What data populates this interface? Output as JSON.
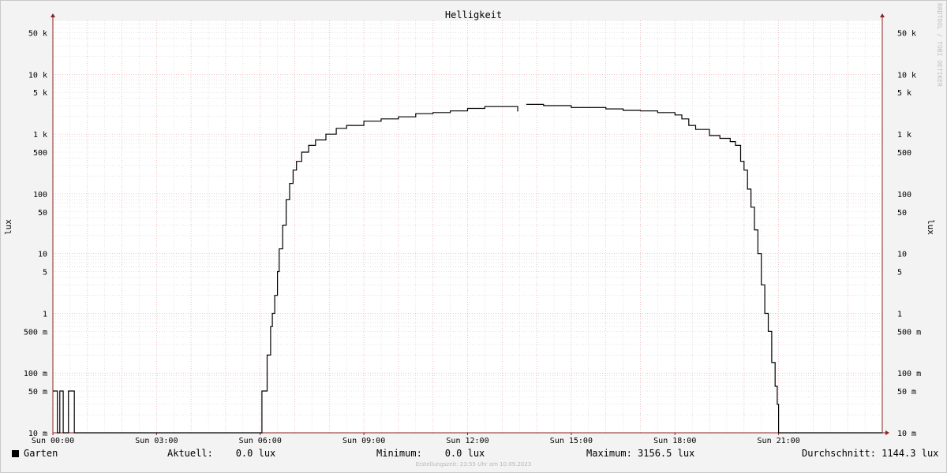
{
  "chart_data": {
    "type": "line",
    "title": "Helligkeit",
    "ylabel": "lux",
    "y_scale": "log",
    "ylim": [
      0.01,
      80000
    ],
    "xlim": [
      0,
      24
    ],
    "x_ticks": [
      {
        "hour": 0,
        "label": "Sun 00:00"
      },
      {
        "hour": 3,
        "label": "Sun 03:00"
      },
      {
        "hour": 6,
        "label": "Sun 06:00"
      },
      {
        "hour": 9,
        "label": "Sun 09:00"
      },
      {
        "hour": 12,
        "label": "Sun 12:00"
      },
      {
        "hour": 15,
        "label": "Sun 15:00"
      },
      {
        "hour": 18,
        "label": "Sun 18:00"
      },
      {
        "hour": 21,
        "label": "Sun 21:00"
      }
    ],
    "y_ticks": [
      {
        "value": 50000,
        "label": "50 k"
      },
      {
        "value": 10000,
        "label": "10 k"
      },
      {
        "value": 5000,
        "label": "5 k"
      },
      {
        "value": 1000,
        "label": "1 k"
      },
      {
        "value": 500,
        "label": "500"
      },
      {
        "value": 100,
        "label": "100"
      },
      {
        "value": 50,
        "label": "50"
      },
      {
        "value": 10,
        "label": "10"
      },
      {
        "value": 5,
        "label": "5"
      },
      {
        "value": 1,
        "label": "1"
      },
      {
        "value": 0.5,
        "label": "500 m"
      },
      {
        "value": 0.1,
        "label": "100 m"
      },
      {
        "value": 0.05,
        "label": "50 m"
      },
      {
        "value": 0.01,
        "label": "10 m"
      }
    ],
    "series": [
      {
        "name": "Garten",
        "color": "#000000",
        "points": [
          [
            0.0,
            0.05
          ],
          [
            0.13,
            0.05
          ],
          [
            0.13,
            0.0
          ],
          [
            0.2,
            0.0
          ],
          [
            0.2,
            0.05
          ],
          [
            0.3,
            0.05
          ],
          [
            0.3,
            0.0
          ],
          [
            0.45,
            0.0
          ],
          [
            0.45,
            0.05
          ],
          [
            0.62,
            0.05
          ],
          [
            0.62,
            0.0
          ],
          [
            6.0,
            0.0
          ],
          [
            6.05,
            0.05
          ],
          [
            6.15,
            0.05
          ],
          [
            6.2,
            0.2
          ],
          [
            6.3,
            0.6
          ],
          [
            6.35,
            1.0
          ],
          [
            6.42,
            2.0
          ],
          [
            6.5,
            5.0
          ],
          [
            6.55,
            12.0
          ],
          [
            6.65,
            30.0
          ],
          [
            6.75,
            80.0
          ],
          [
            6.85,
            150.0
          ],
          [
            6.95,
            250.0
          ],
          [
            7.05,
            350.0
          ],
          [
            7.2,
            500.0
          ],
          [
            7.4,
            650.0
          ],
          [
            7.6,
            800.0
          ],
          [
            7.9,
            1000.0
          ],
          [
            8.2,
            1250.0
          ],
          [
            8.5,
            1400.0
          ],
          [
            9.0,
            1650.0
          ],
          [
            9.5,
            1800.0
          ],
          [
            10.0,
            1950.0
          ],
          [
            10.5,
            2200.0
          ],
          [
            11.0,
            2300.0
          ],
          [
            11.5,
            2450.0
          ],
          [
            12.0,
            2700.0
          ],
          [
            12.5,
            2900.0
          ],
          [
            13.0,
            2900.0
          ],
          [
            13.4,
            2900.0
          ],
          [
            13.45,
            2400.0
          ],
          [
            13.5,
            null
          ],
          [
            13.7,
            3156.5
          ],
          [
            14.2,
            3000.0
          ],
          [
            15.0,
            2800.0
          ],
          [
            16.0,
            2650.0
          ],
          [
            16.5,
            2500.0
          ],
          [
            17.0,
            2450.0
          ],
          [
            17.5,
            2300.0
          ],
          [
            18.0,
            2100.0
          ],
          [
            18.2,
            1800.0
          ],
          [
            18.4,
            1400.0
          ],
          [
            18.6,
            1200.0
          ],
          [
            18.9,
            1200.0
          ],
          [
            19.0,
            950.0
          ],
          [
            19.3,
            850.0
          ],
          [
            19.6,
            750.0
          ],
          [
            19.75,
            650.0
          ],
          [
            19.9,
            350.0
          ],
          [
            20.0,
            250.0
          ],
          [
            20.1,
            120.0
          ],
          [
            20.2,
            60.0
          ],
          [
            20.3,
            25.0
          ],
          [
            20.4,
            10.0
          ],
          [
            20.5,
            3.0
          ],
          [
            20.6,
            1.0
          ],
          [
            20.7,
            0.5
          ],
          [
            20.8,
            0.15
          ],
          [
            20.9,
            0.06
          ],
          [
            20.96,
            0.03
          ],
          [
            21.0,
            0.0
          ],
          [
            24.0,
            0.0
          ]
        ]
      }
    ],
    "grid": true,
    "legend": "bottom"
  },
  "legend": {
    "series_label": "Garten",
    "current": "Aktuell:    0.0 lux",
    "minimum": "Minimum:    0.0 lux",
    "maximum": "Maximum: 3156.5 lux",
    "average": "Durchschnitt: 1144.3 lux"
  },
  "footer": "Erstellungszeit: 23:55 Uhr am 10.09.2023",
  "watermark": "RRDTOOL / TOBI OETIKER",
  "colors": {
    "background": "#f3f3f3",
    "plot_bg": "#ffffff",
    "major_grid": "#e8a8a8",
    "minor_grid": "#d2d2d2",
    "axis": "#8b2222",
    "line": "#000000"
  }
}
